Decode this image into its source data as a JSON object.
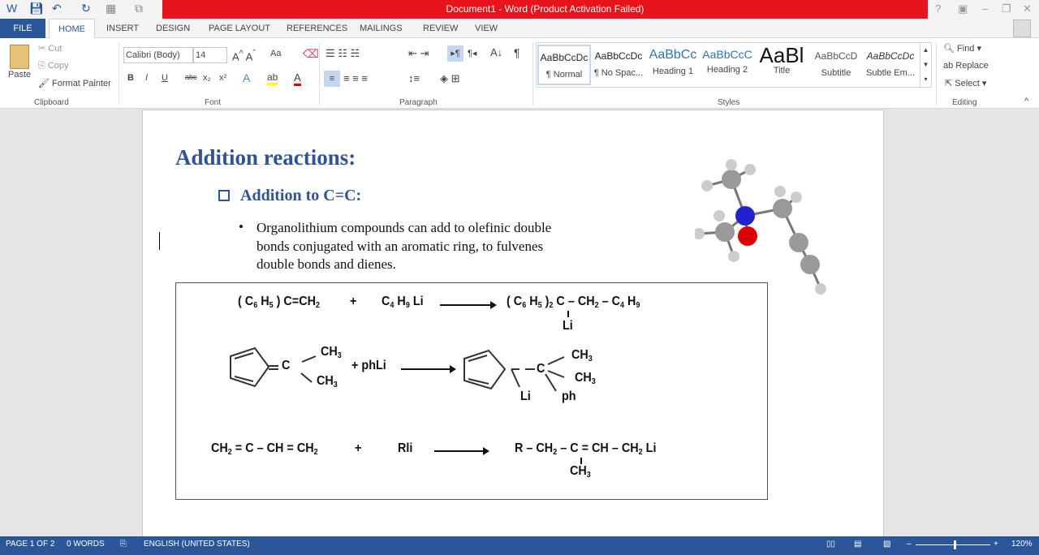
{
  "window": {
    "title": "Document1 - Word (Product Activation Failed)",
    "help": "?",
    "minimize": "–",
    "restore": "❐",
    "close": "✕"
  },
  "tabs": [
    "FILE",
    "HOME",
    "INSERT",
    "DESIGN",
    "PAGE LAYOUT",
    "REFERENCES",
    "MAILINGS",
    "REVIEW",
    "VIEW"
  ],
  "clipboard": {
    "paste": "Paste",
    "cut": "Cut",
    "copy": "Copy",
    "format_painter": "Format Painter",
    "label": "Clipboard"
  },
  "font": {
    "name": "Calibri (Body)",
    "size": "14",
    "label": "Font",
    "bold": "B",
    "italic": "I",
    "underline": "U",
    "strike": "abc",
    "sub": "x₂",
    "sup": "x²",
    "case": "Aa"
  },
  "paragraph": {
    "label": "Paragraph"
  },
  "styles": {
    "label": "Styles",
    "items": [
      {
        "preview": "AaBbCcDc",
        "name": "¶ Normal"
      },
      {
        "preview": "AaBbCcDc",
        "name": "¶ No Spac..."
      },
      {
        "preview": "AaBbCc",
        "name": "Heading 1"
      },
      {
        "preview": "AaBbCcC",
        "name": "Heading 2"
      },
      {
        "preview": "AaBl",
        "name": "Title"
      },
      {
        "preview": "AaBbCcD",
        "name": "Subtitle"
      },
      {
        "preview": "AaBbCcDc",
        "name": "Subtle Em..."
      }
    ]
  },
  "editing": {
    "find": "Find",
    "replace": "Replace",
    "select": "Select",
    "label": "Editing"
  },
  "document": {
    "heading": "Addition reactions:",
    "subheading": "Addition to C=C:",
    "bullet_lines": [
      "Organolithium compounds can add to olefinic double",
      "bonds conjugated with an aromatic ring, to fulvenes",
      "double bonds and dienes."
    ],
    "reactions": {
      "r1_reactant": [
        [
          "( C"
        ],
        [
          "6",
          "s"
        ],
        [
          " H"
        ],
        [
          "5",
          "s"
        ],
        [
          " )  C=CH"
        ],
        [
          "2",
          "s"
        ]
      ],
      "r1_plus": "+",
      "r1_reagent": [
        [
          "C"
        ],
        [
          "4",
          "s"
        ],
        [
          " H"
        ],
        [
          "9",
          "s"
        ],
        [
          " Li"
        ]
      ],
      "r1_product": [
        [
          "( C"
        ],
        [
          "6",
          "s"
        ],
        [
          " H"
        ],
        [
          "5",
          "s"
        ],
        [
          " )"
        ],
        [
          "2",
          "s"
        ],
        [
          " C – CH"
        ],
        [
          "2",
          "s"
        ],
        [
          " – C"
        ],
        [
          "4",
          "s"
        ],
        [
          " H"
        ],
        [
          "9",
          "s"
        ]
      ],
      "r1_li": "Li",
      "r2_c": "C",
      "r2_ch3a": [
        [
          "CH"
        ],
        [
          "3",
          "s"
        ]
      ],
      "r2_ch3b": [
        [
          "CH"
        ],
        [
          "3",
          "s"
        ]
      ],
      "r2_reagent": "+ phLi",
      "r2_pc": "C",
      "r2_pch3a": [
        [
          "CH"
        ],
        [
          "3",
          "s"
        ]
      ],
      "r2_pch3b": [
        [
          "CH"
        ],
        [
          "3",
          "s"
        ]
      ],
      "r2_li": "Li",
      "r2_ph": "ph",
      "r3_reactant": [
        [
          "CH"
        ],
        [
          "2",
          "s"
        ],
        [
          " = C – CH = CH"
        ],
        [
          "2",
          "s"
        ]
      ],
      "r3_plus": "+",
      "r3_reagent": "Rli",
      "r3_product": [
        [
          "R – CH"
        ],
        [
          "2",
          "s"
        ],
        [
          " – C = CH – CH"
        ],
        [
          "2",
          "s"
        ],
        [
          " Li"
        ]
      ],
      "r3_ch3": [
        [
          "CH"
        ],
        [
          "3",
          "s"
        ]
      ]
    }
  },
  "status": {
    "page": "PAGE 1 OF 2",
    "words": "0 WORDS",
    "language": "ENGLISH (UNITED STATES)",
    "zoom": "120%"
  },
  "colors": {
    "accent": "#2b579a",
    "titlebar_red": "#e8131b",
    "heading": "#2f5496"
  }
}
